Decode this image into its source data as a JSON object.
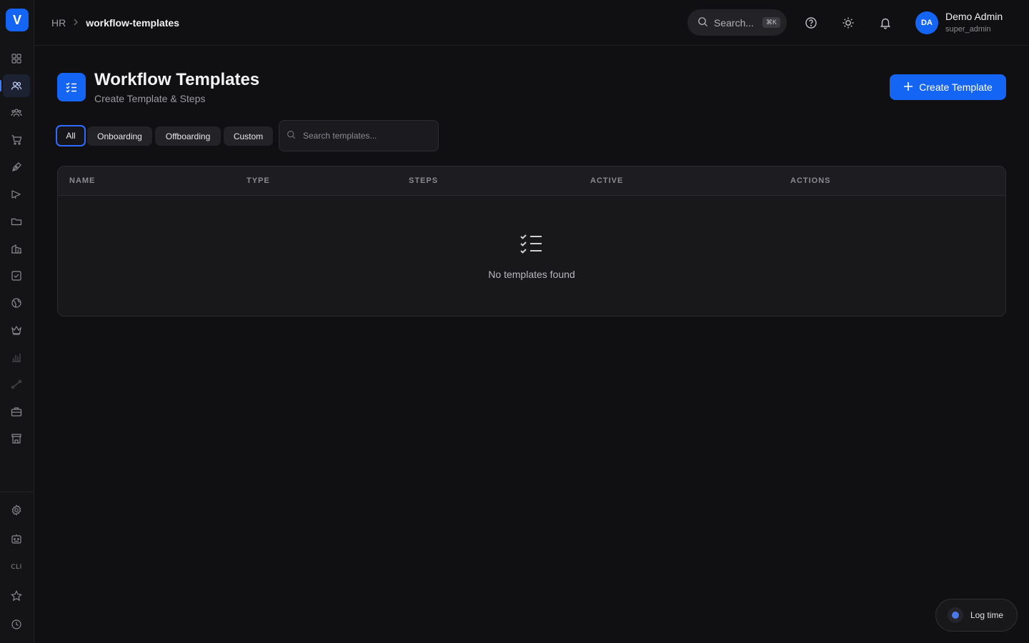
{
  "app": {
    "logo_letter": "V",
    "accent_color": "#1565f5"
  },
  "sidebar": {
    "items": [
      {
        "icon": "grid-icon"
      },
      {
        "icon": "users-icon",
        "active": true
      },
      {
        "icon": "team-icon"
      },
      {
        "icon": "cart-icon"
      },
      {
        "icon": "pen-tool-icon"
      },
      {
        "icon": "megaphone-icon"
      },
      {
        "icon": "folder-icon"
      },
      {
        "icon": "building-icon"
      },
      {
        "icon": "checkbox-icon"
      },
      {
        "icon": "globe-icon"
      },
      {
        "icon": "crown-icon"
      },
      {
        "icon": "bar-chart-icon"
      },
      {
        "icon": "route-icon"
      },
      {
        "icon": "briefcase-icon"
      },
      {
        "icon": "store-icon"
      }
    ],
    "bottom_items": [
      {
        "icon": "gear-icon"
      },
      {
        "icon": "robot-icon"
      },
      {
        "label": "CLI"
      },
      {
        "icon": "star-icon"
      },
      {
        "icon": "clock-icon"
      }
    ]
  },
  "topbar": {
    "breadcrumb": [
      "HR",
      "workflow-templates"
    ],
    "search_label": "Search...",
    "search_shortcut": "⌘K",
    "user": {
      "initials": "DA",
      "name": "Demo Admin",
      "role": "super_admin"
    }
  },
  "page": {
    "title": "Workflow Templates",
    "subtitle": "Create Template & Steps",
    "create_button": "Create Template"
  },
  "filters": {
    "tabs": [
      "All",
      "Onboarding",
      "Offboarding",
      "Custom"
    ],
    "selected": "All",
    "search_placeholder": "Search templates..."
  },
  "table": {
    "columns": [
      "NAME",
      "TYPE",
      "STEPS",
      "ACTIVE",
      "ACTIONS"
    ],
    "rows": [],
    "empty_message": "No templates found"
  },
  "log_time": {
    "label": "Log time"
  }
}
